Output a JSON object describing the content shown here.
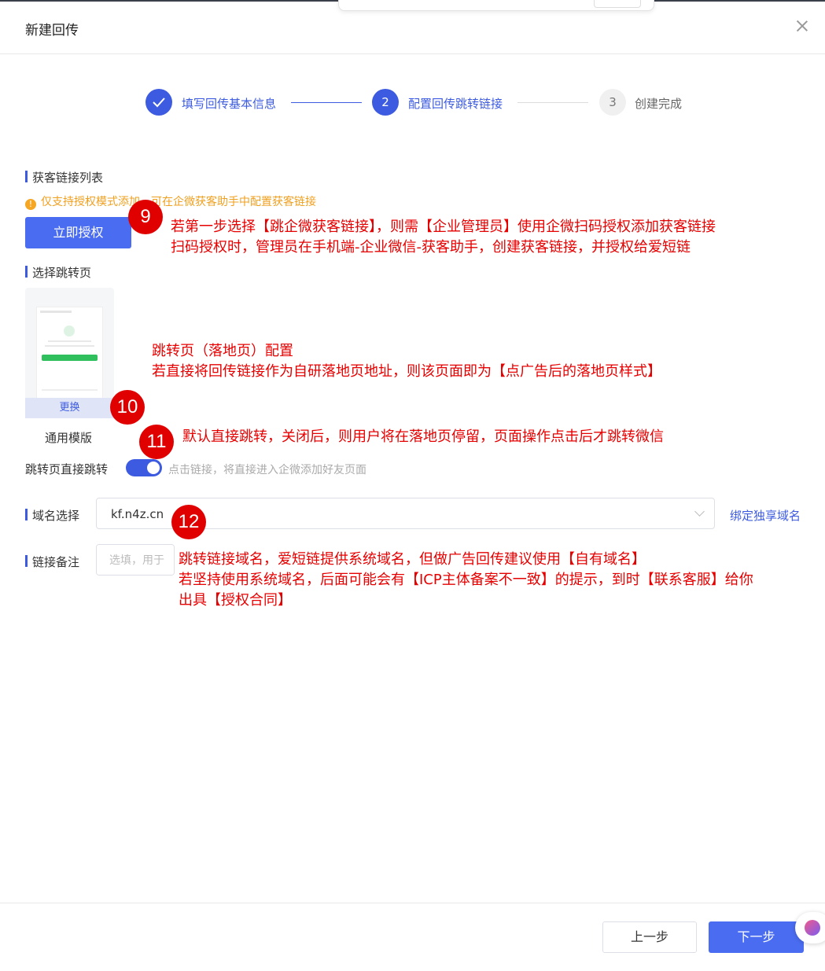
{
  "dialog": {
    "title": "新建回传"
  },
  "steps": [
    {
      "label": "填写回传基本信息",
      "status": "done"
    },
    {
      "number": "2",
      "label": "配置回传跳转链接",
      "status": "active"
    },
    {
      "number": "3",
      "label": "创建完成",
      "status": "pending"
    }
  ],
  "acquisition": {
    "title": "获客链接列表",
    "warning": "仅支持授权模式添加，可在企微获客助手中配置获客链接",
    "authorize_button": "立即授权"
  },
  "landing": {
    "title": "选择跳转页",
    "change_label": "更换",
    "template_name": "通用模版"
  },
  "direct_jump": {
    "label": "跳转页直接跳转",
    "enabled": true,
    "hint": "点击链接，将直接进入企微添加好友页面"
  },
  "domain": {
    "label": "域名选择",
    "value": "kf.n4z.cn",
    "bind_link": "绑定独享域名"
  },
  "remark": {
    "label": "链接备注",
    "placeholder": "选填，用于"
  },
  "annotations": [
    {
      "number": "9",
      "lines": [
        "若第一步选择【跳企微获客链接】，则需【企业管理员】使用企微扫码授权添加获客链接",
        "扫码授权时，管理员在手机端-企业微信-获客助手，创建获客链接，并授权给爱短链"
      ]
    },
    {
      "number": "10",
      "lines": [
        "跳转页（落地页）配置",
        "若直接将回传链接作为自研落地页地址，则该页面即为【点广告后的落地页样式】"
      ]
    },
    {
      "number": "11",
      "lines": [
        "默认直接跳转，关闭后，则用户将在落地页停留，页面操作点击后才跳转微信"
      ]
    },
    {
      "number": "12",
      "lines": [
        "跳转链接域名，爱短链提供系统域名，但做广告回传建议使用【自有域名】",
        "若坚持使用系统域名，后面可能会有【ICP主体备案不一致】的提示，到时【联系客服】给你",
        "出具【授权合同】"
      ]
    }
  ],
  "footer": {
    "prev": "上一步",
    "next": "下一步"
  },
  "colors": {
    "primary": "#3d5be0",
    "annotation": "#e00000",
    "warning": "#f0a020"
  }
}
